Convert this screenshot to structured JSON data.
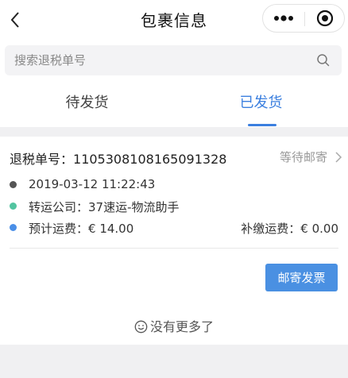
{
  "navbar": {
    "title": "包裹信息",
    "back_icon": "chevron-left-icon",
    "more_icon": "more-dots-icon",
    "close_icon": "target-close-icon"
  },
  "search": {
    "placeholder": "搜索退税单号",
    "value": "",
    "icon": "search-icon"
  },
  "tabs": [
    {
      "label": "待发货",
      "active": false
    },
    {
      "label": "已发货",
      "active": true
    }
  ],
  "colors": {
    "accent": "#3b7fdf",
    "button": "#4a90e2",
    "dot_time": "#555555",
    "dot_company": "#52c4a0",
    "dot_fee": "#4a8fe7"
  },
  "order": {
    "number_label": "退税单号：",
    "number_value": "1105308108165091328",
    "status": "等待邮寄",
    "datetime": "2019-03-12 11:22:43",
    "company_label": "转运公司：",
    "company_value": "37速运-物流助手",
    "estimated_fee_label": "预计运费：",
    "estimated_fee_value": "€ 14.00",
    "extra_fee_label": "补缴运费：",
    "extra_fee_value": "€ 0.00",
    "mail_button": "邮寄发票"
  },
  "footer": {
    "no_more": "没有更多了"
  }
}
